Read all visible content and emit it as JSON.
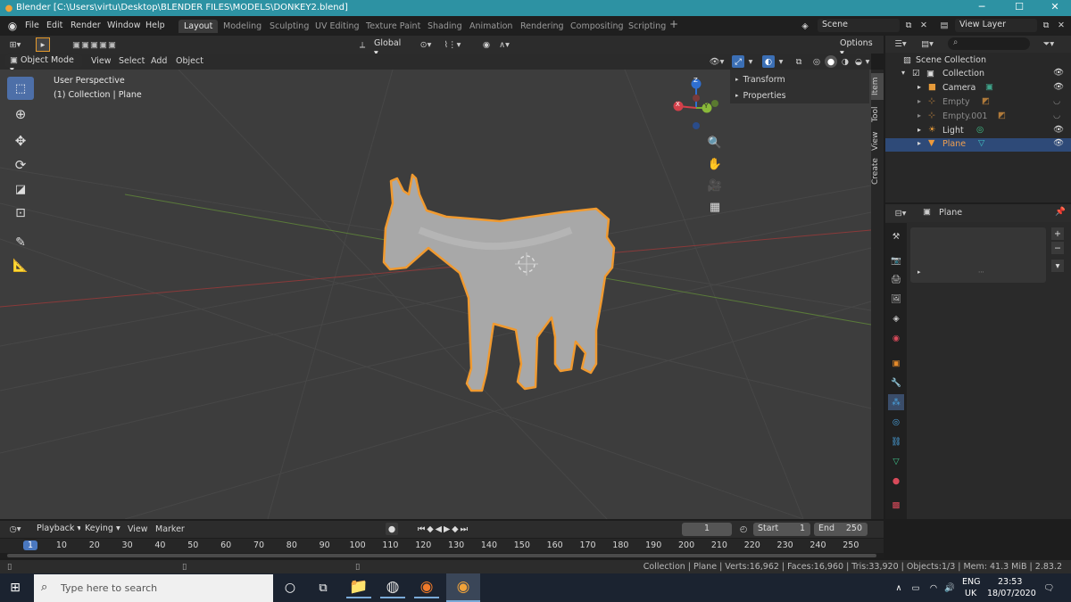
{
  "window": {
    "title": "Blender [C:\\Users\\virtu\\Desktop\\BLENDER FILES\\MODELS\\DONKEY2.blend]"
  },
  "menu": [
    "File",
    "Edit",
    "Render",
    "Window",
    "Help"
  ],
  "workspaces": [
    "Layout",
    "Modeling",
    "Sculpting",
    "UV Editing",
    "Texture Paint",
    "Shading",
    "Animation",
    "Rendering",
    "Compositing",
    "Scripting"
  ],
  "scene": {
    "label": "Scene",
    "view_layer": "View Layer"
  },
  "header": {
    "mode": "Object Mode",
    "view": "View",
    "select": "Select",
    "add": "Add",
    "object": "Object",
    "transform": "Global",
    "options": "Options"
  },
  "viewport": {
    "perspective": "User Perspective",
    "collection": "(1) Collection | Plane"
  },
  "npanel": {
    "transform": "Transform",
    "properties": "Properties",
    "tabs": [
      "Item",
      "Tool",
      "View",
      "Create"
    ]
  },
  "gizmo": {
    "x": "X",
    "y": "Y",
    "z": "Z"
  },
  "outliner": {
    "root": "Scene Collection",
    "collection": "Collection",
    "items": [
      "Camera",
      "Empty",
      "Empty.001",
      "Light",
      "Plane"
    ]
  },
  "properties": {
    "object": "Plane"
  },
  "timeline": {
    "playback": "Playback",
    "keying": "Keying",
    "view": "View",
    "marker": "Marker",
    "current": "1",
    "start_label": "Start",
    "start": "1",
    "end_label": "End",
    "end": "250",
    "ticks": [
      "1",
      "10",
      "20",
      "30",
      "40",
      "50",
      "60",
      "70",
      "80",
      "90",
      "100",
      "110",
      "120",
      "130",
      "140",
      "150",
      "160",
      "170",
      "180",
      "190",
      "200",
      "210",
      "220",
      "230",
      "240",
      "250"
    ]
  },
  "status": {
    "text": "Collection | Plane | Verts:16,962 | Faces:16,960 | Tris:33,920 | Objects:1/3 | Mem: 41.3 MiB | 2.83.2"
  },
  "taskbar": {
    "search": "Type here to search",
    "lang1": "ENG",
    "lang2": "UK",
    "time": "23:53",
    "date": "18/07/2020"
  },
  "colors": {
    "accent": "#2d92a3",
    "selection": "#ee9a3a",
    "taskbar": "#1b2330"
  }
}
